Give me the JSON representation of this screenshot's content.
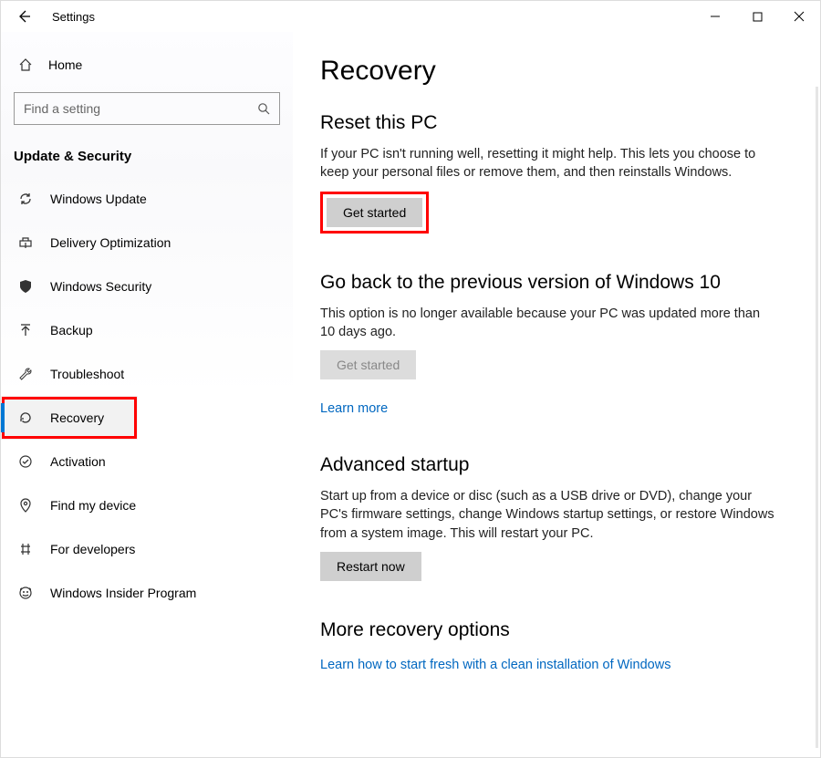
{
  "titlebar": {
    "title": "Settings"
  },
  "sidebar": {
    "home_label": "Home",
    "search_placeholder": "Find a setting",
    "section_header": "Update & Security",
    "items": [
      {
        "label": "Windows Update",
        "icon": "refresh"
      },
      {
        "label": "Delivery Optimization",
        "icon": "delivery"
      },
      {
        "label": "Windows Security",
        "icon": "shield"
      },
      {
        "label": "Backup",
        "icon": "backup"
      },
      {
        "label": "Troubleshoot",
        "icon": "wrench"
      },
      {
        "label": "Recovery",
        "icon": "recovery",
        "selected": true,
        "highlighted": true
      },
      {
        "label": "Activation",
        "icon": "check"
      },
      {
        "label": "Find my device",
        "icon": "location"
      },
      {
        "label": "For developers",
        "icon": "developers"
      },
      {
        "label": "Windows Insider Program",
        "icon": "insider"
      }
    ]
  },
  "content": {
    "page_title": "Recovery",
    "reset": {
      "heading": "Reset this PC",
      "desc": "If your PC isn't running well, resetting it might help. This lets you choose to keep your personal files or remove them, and then reinstalls Windows.",
      "button": "Get started"
    },
    "goback": {
      "heading": "Go back to the previous version of Windows 10",
      "desc": "This option is no longer available because your PC was updated more than 10 days ago.",
      "button": "Get started",
      "link": "Learn more"
    },
    "advanced": {
      "heading": "Advanced startup",
      "desc": "Start up from a device or disc (such as a USB drive or DVD), change your PC's firmware settings, change Windows startup settings, or restore Windows from a system image. This will restart your PC.",
      "button": "Restart now"
    },
    "more": {
      "heading": "More recovery options",
      "link": "Learn how to start fresh with a clean installation of Windows"
    }
  }
}
